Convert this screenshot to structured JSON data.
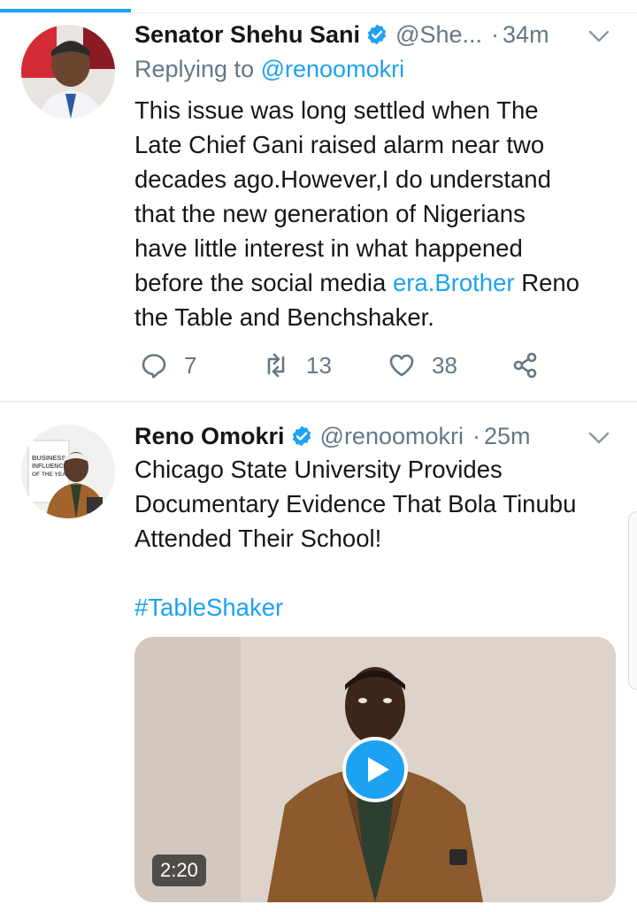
{
  "tweets": [
    {
      "author": "Senator Shehu Sani",
      "handle": "@She...",
      "separator": "·",
      "time": "34m",
      "replying_prefix": "Replying to",
      "replying_to": "@renoomokri",
      "text_lines": [
        "This issue was long settled when The",
        "Late Chief Gani raised alarm near two",
        "decades ago.However,I do understand",
        "that the new generation of Nigerians",
        "have little interest in what happened"
      ],
      "line6_before": "before the social media ",
      "line6_link": "era.Brother",
      "line6_after": " Reno",
      "line7": "the Table and Benchshaker.",
      "replies": "7",
      "retweets": "13",
      "likes": "38"
    },
    {
      "author": "Reno Omokri",
      "handle": "@renoomokri",
      "separator": "·",
      "time": "25m",
      "text_lines": [
        "Chicago State University Provides",
        "Documentary Evidence That Bola Tinubu",
        "Attended Their School!"
      ],
      "hashtag": "#TableShaker",
      "video_duration": "2:20",
      "avatar_poster_lines": [
        "BUSINESS",
        "INFLUENCER",
        "OF THE YEAR"
      ]
    }
  ],
  "colors": {
    "accent": "#1da1f2",
    "muted": "#657786",
    "text": "#14171a",
    "divider": "#e6ecf0"
  },
  "icons": [
    "verified-badge-icon",
    "chevron-down-icon",
    "reply-icon",
    "retweet-icon",
    "like-icon",
    "share-icon",
    "play-icon"
  ]
}
